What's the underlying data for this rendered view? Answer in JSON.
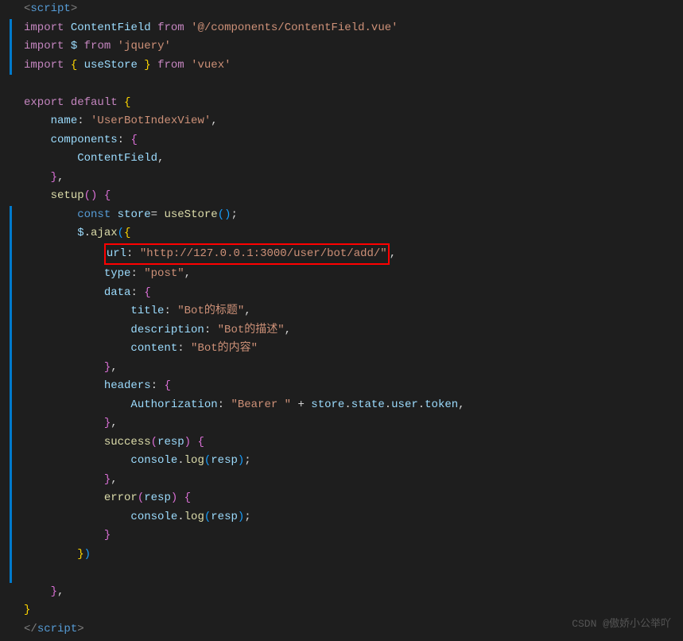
{
  "code": {
    "line1": {
      "tag_open": "<",
      "tagname": "script",
      "tag_close": ">"
    },
    "line2": {
      "keyword1": "import",
      "var": "ContentField",
      "keyword2": "from",
      "str": "'@/components/ContentField.vue'"
    },
    "line3": {
      "keyword1": "import",
      "var": "$",
      "keyword2": "from",
      "str": "'jquery'"
    },
    "line4": {
      "keyword1": "import",
      "brace1": "{",
      "var": "useStore",
      "brace2": "}",
      "keyword2": "from",
      "str": "'vuex'"
    },
    "line6": {
      "keyword1": "export",
      "keyword2": "default",
      "brace": "{"
    },
    "line7": {
      "prop": "name",
      "colon": ":",
      "str": "'UserBotIndexView'",
      "comma": ","
    },
    "line8": {
      "prop": "components",
      "colon": ":",
      "brace": "{"
    },
    "line9": {
      "var": "ContentField",
      "comma": ","
    },
    "line10": {
      "brace": "}",
      "comma": ","
    },
    "line11": {
      "func": "setup",
      "paren1": "(",
      "paren2": ")",
      "brace": "{"
    },
    "line12": {
      "keyword": "const",
      "var1": "store",
      "op": "=",
      "func": "useStore",
      "paren1": "(",
      "paren2": ")",
      "semi": ";"
    },
    "line13": {
      "var": "$",
      "dot": ".",
      "func": "ajax",
      "paren1": "(",
      "brace": "{"
    },
    "line14": {
      "prop": "url",
      "colon": ":",
      "str": "\"http://127.0.0.1:3000/user/bot/add/\"",
      "comma": ","
    },
    "line15": {
      "prop": "type",
      "colon": ":",
      "str": "\"post\"",
      "comma": ","
    },
    "line16": {
      "prop": "data",
      "colon": ":",
      "brace": "{"
    },
    "line17": {
      "prop": "title",
      "colon": ":",
      "str": "\"Bot的标题\"",
      "comma": ","
    },
    "line18": {
      "prop": "description",
      "colon": ":",
      "str": "\"Bot的描述\"",
      "comma": ","
    },
    "line19": {
      "prop": "content",
      "colon": ":",
      "str": "\"Bot的内容\""
    },
    "line20": {
      "brace": "}",
      "comma": ","
    },
    "line21": {
      "prop": "headers",
      "colon": ":",
      "brace": "{"
    },
    "line22": {
      "prop": "Authorization",
      "colon": ":",
      "str": "\"Bearer \"",
      "op": "+",
      "var1": "store",
      "dot1": ".",
      "var2": "state",
      "dot2": ".",
      "var3": "user",
      "dot3": ".",
      "var4": "token",
      "comma": ","
    },
    "line23": {
      "brace": "}",
      "comma": ","
    },
    "line24": {
      "func": "success",
      "paren1": "(",
      "param": "resp",
      "paren2": ")",
      "brace": "{"
    },
    "line25": {
      "var1": "console",
      "dot": ".",
      "func": "log",
      "paren1": "(",
      "param": "resp",
      "paren2": ")",
      "semi": ";"
    },
    "line26": {
      "brace": "}",
      "comma": ","
    },
    "line27": {
      "func": "error",
      "paren1": "(",
      "param": "resp",
      "paren2": ")",
      "brace": "{"
    },
    "line28": {
      "var1": "console",
      "dot": ".",
      "func": "log",
      "paren1": "(",
      "param": "resp",
      "paren2": ")",
      "semi": ";"
    },
    "line29": {
      "brace": "}"
    },
    "line30": {
      "brace": "}",
      "paren": ")"
    },
    "line32": {
      "brace": "}",
      "comma": ","
    },
    "line33": {
      "brace": "}"
    },
    "line34": {
      "tag_open": "</",
      "tagname": "script",
      "tag_close": ">"
    }
  },
  "watermark": "CSDN @傲娇小公举吖"
}
